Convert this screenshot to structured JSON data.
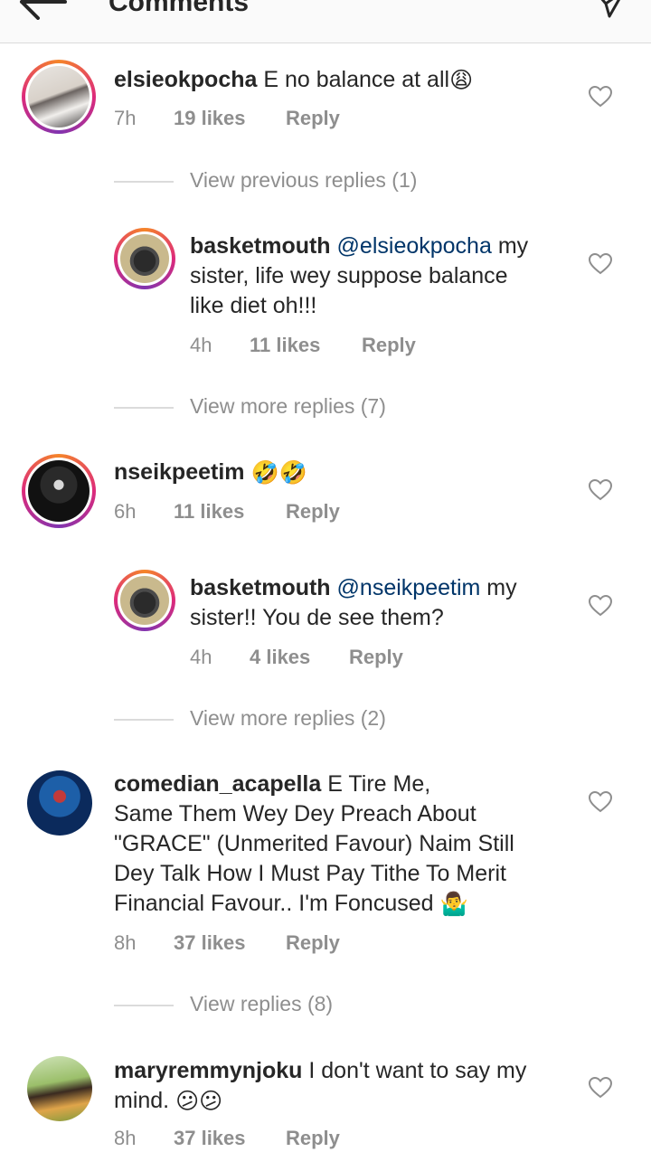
{
  "header": {
    "title": "Comments"
  },
  "comments": [
    {
      "username": "elsieokpocha",
      "text": "E no balance at all",
      "emoji": "😩",
      "time": "7h",
      "likes": "19 likes",
      "reply": "Reply",
      "thread": [
        {
          "view_label": "View previous replies (1)"
        },
        {
          "username": "basketmouth",
          "mention": "@elsieokpocha",
          "line1": "my",
          "line2": "sister, life wey suppose balance",
          "line3": "like diet oh!!!",
          "time": "4h",
          "likes": "11 likes",
          "reply": "Reply"
        },
        {
          "view_label": "View more replies (7)"
        }
      ]
    },
    {
      "username": "nseikpeetim",
      "emoji": "🤣🤣",
      "time": "6h",
      "likes": "11 likes",
      "reply": "Reply",
      "thread": [
        {
          "username": "basketmouth",
          "mention": "@nseikpeetim",
          "line1": "my",
          "line2": "sister!! You de see them?",
          "time": "4h",
          "likes": "4 likes",
          "reply": "Reply"
        },
        {
          "view_label": "View more replies (2)"
        }
      ]
    },
    {
      "username": "comedian_acapella",
      "line1": "E Tire Me,",
      "line2": "Same Them Wey Dey Preach About",
      "line3": "\"GRACE\" (Unmerited Favour) Naim Still",
      "line4": "Dey Talk How I Must Pay Tithe To Merit",
      "line5": "Financial Favour.. I'm Foncused",
      "emoji": "🤷‍♂️",
      "time": "8h",
      "likes": "37 likes",
      "reply": "Reply",
      "thread": [
        {
          "view_label": "View replies (8)"
        }
      ]
    },
    {
      "username": "maryremmynjoku",
      "line1": "I don't want to say my",
      "line2": "mind.",
      "emoji": "😕😕",
      "time": "8h",
      "likes": "37 likes",
      "reply": "Reply"
    }
  ],
  "colors": {
    "text": "#262626",
    "muted": "#8e8e8e",
    "mention": "#003569",
    "ring_start": "#f58529",
    "ring_end": "#8134af"
  },
  "icons": {
    "back": "arrow-left-icon",
    "send": "paper-plane-icon",
    "like": "heart-outline-icon"
  }
}
